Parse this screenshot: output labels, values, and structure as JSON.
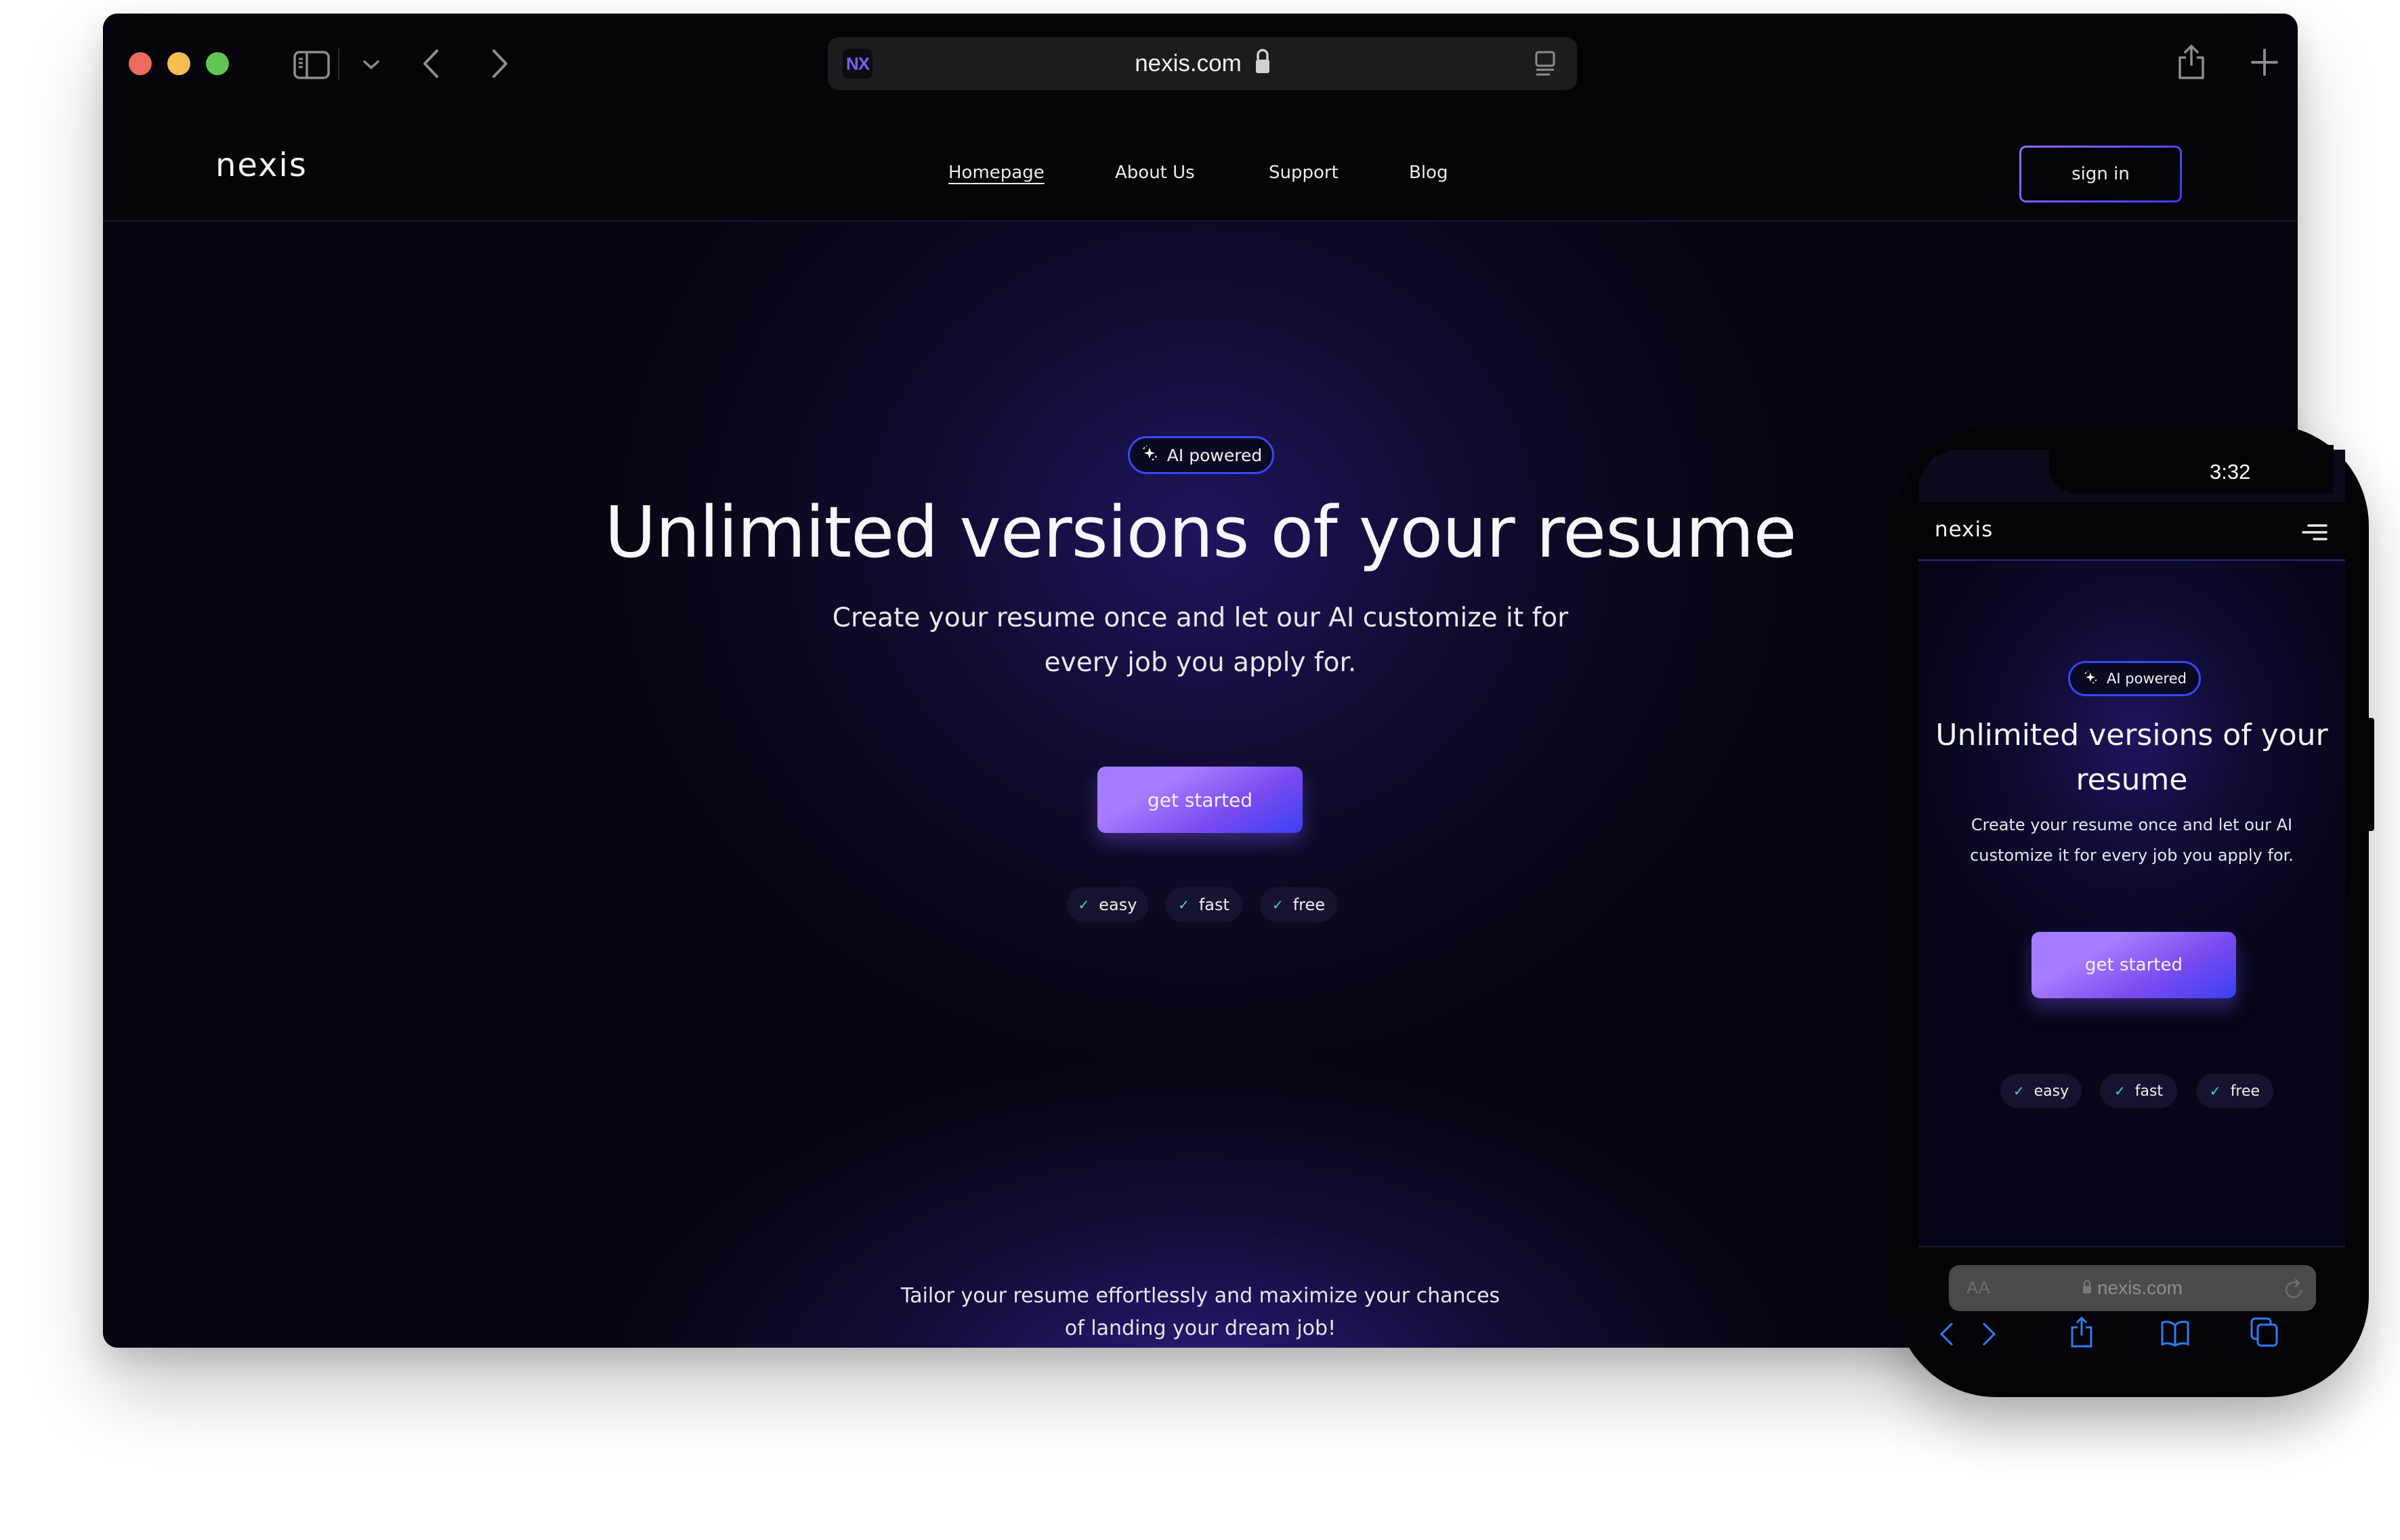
{
  "browser": {
    "url": "nexis.com",
    "favicon_text": "NX",
    "toolbar_icons": [
      "sidebar-icon",
      "chevron-down-icon",
      "back-icon",
      "forward-icon",
      "lock-icon",
      "reader-icon",
      "share-icon",
      "new-tab-icon",
      "tabs-overview-icon"
    ],
    "traffic_lights": {
      "close": "#ed6a5e",
      "minimize": "#f4bf4f",
      "zoom": "#61c554"
    }
  },
  "site": {
    "logo": "nexis",
    "nav": [
      {
        "label": "Homepage",
        "active": true
      },
      {
        "label": "About Us",
        "active": false
      },
      {
        "label": "Support",
        "active": false
      },
      {
        "label": "Blog",
        "active": false
      }
    ],
    "sign_in": "sign in",
    "badge": "AI powered",
    "title": "Unlimited versions of your resume",
    "subtitle": "Create your resume once and let our AI customize it for every job you apply for.",
    "cta": "get started",
    "chips": [
      "easy",
      "fast",
      "free"
    ],
    "footer_text": "Tailor your resume effortlessly and maximize your chances of landing your dream job!",
    "colors": {
      "accent_start": "#a27cff",
      "accent_end": "#3b40f2",
      "check": "#3ee0c4",
      "badge_border": "#3a45ff"
    }
  },
  "phone": {
    "time": "3:32",
    "logo": "nexis",
    "badge": "AI powered",
    "title": "Unlimited versions of your resume",
    "subtitle": "Create your resume once and let our AI customize it for every job you apply for.",
    "cta": "get started",
    "chips": [
      "easy",
      "fast",
      "free"
    ],
    "url_aa": "AA",
    "url": "nexis.com",
    "toolbar_icons": [
      "back-icon",
      "forward-icon",
      "share-icon",
      "bookmarks-icon",
      "tabs-icon"
    ],
    "toolbar_color": "#2f7cf6"
  }
}
